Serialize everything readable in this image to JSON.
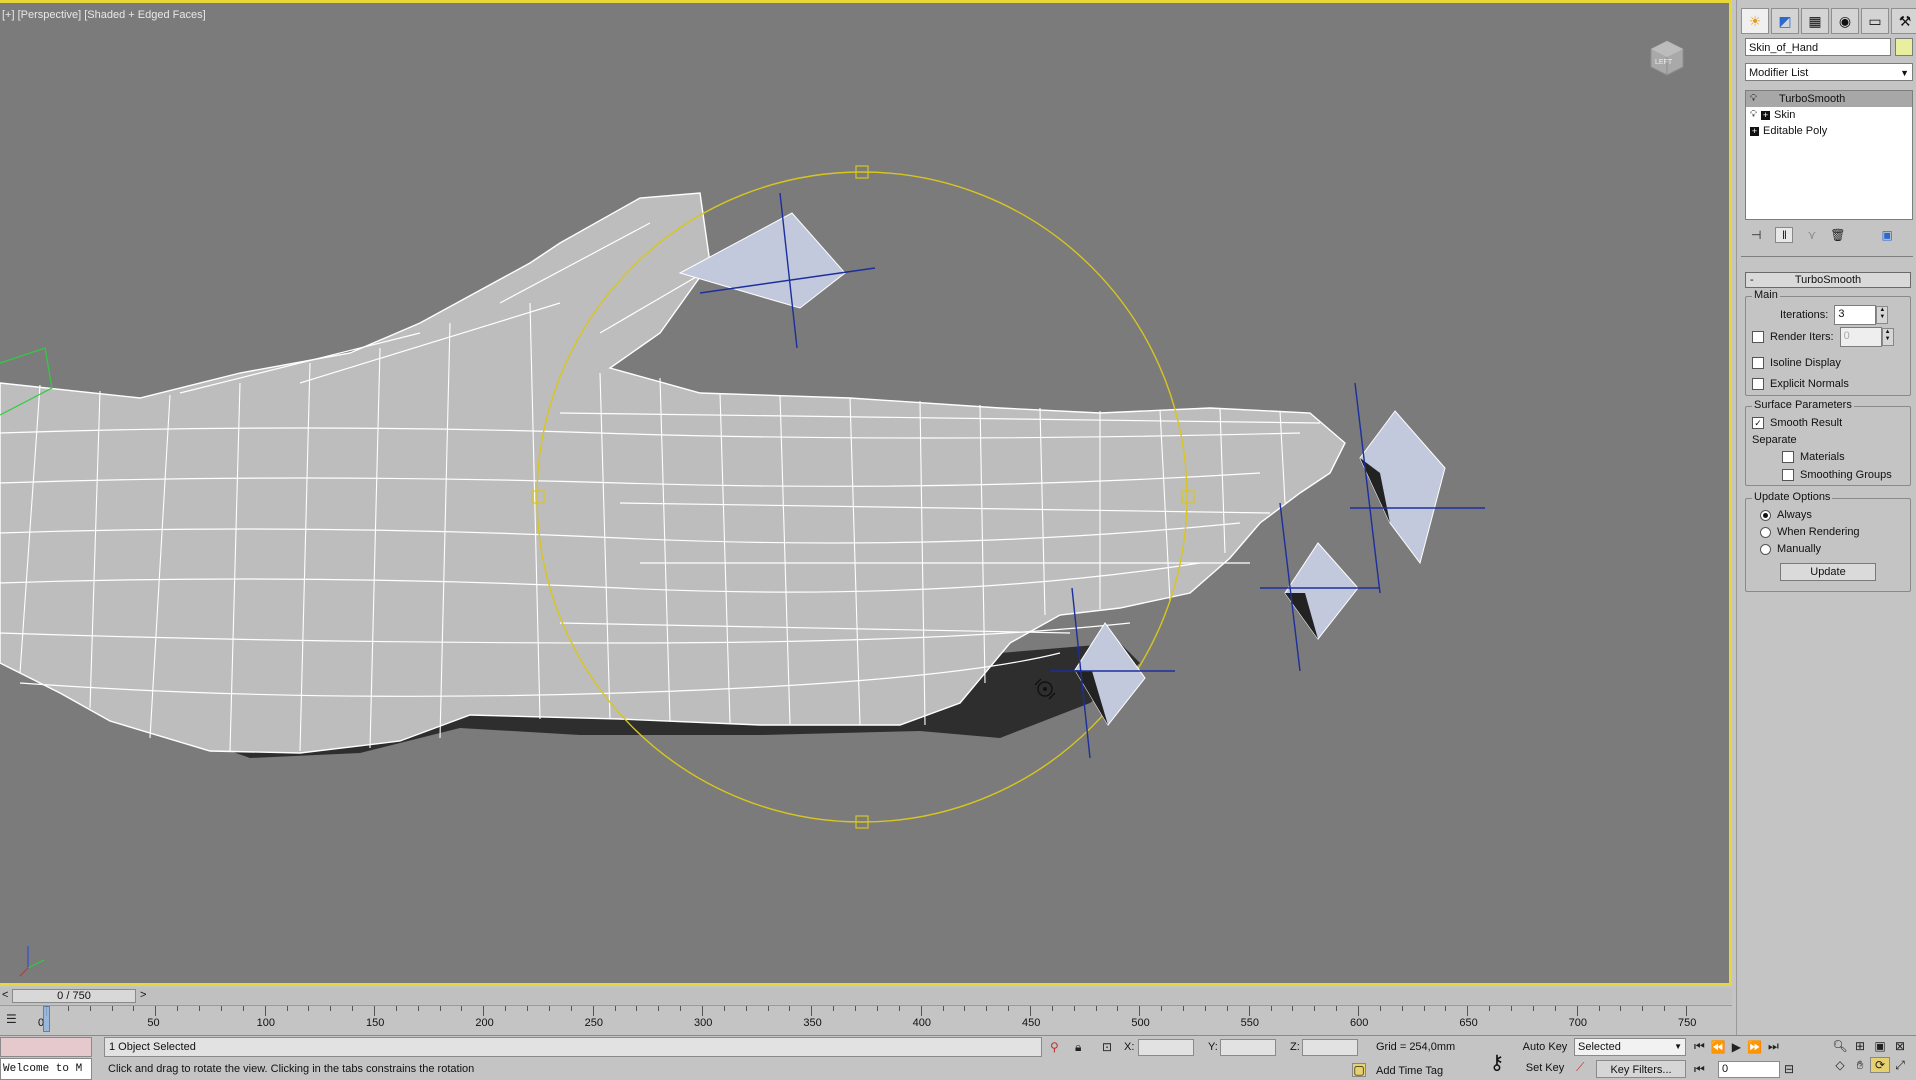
{
  "viewport": {
    "label": "[+] [Perspective] [Shaded + Edged Faces]",
    "viewcube_label": "LEFT",
    "axis_labels": {
      "x": "x",
      "y": "y",
      "z": "z"
    }
  },
  "command_panel": {
    "tabs": [
      {
        "name": "create-tab",
        "glyph": "☀",
        "active": true
      },
      {
        "name": "modify-tab",
        "glyph": "◩",
        "active": false
      },
      {
        "name": "hierarchy-tab",
        "glyph": "▦",
        "active": false
      },
      {
        "name": "motion-tab",
        "glyph": "◉",
        "active": false
      },
      {
        "name": "display-tab",
        "glyph": "▭",
        "active": false
      },
      {
        "name": "utilities-tab",
        "glyph": "⚒",
        "active": false
      }
    ],
    "object_name": "Skin_of_Hand",
    "object_color": "#e8f0a0",
    "modifier_list_label": "Modifier List",
    "stack": [
      {
        "label": "TurboSmooth",
        "selected": true,
        "bulb": true,
        "plus": false
      },
      {
        "label": "Skin",
        "selected": false,
        "bulb": true,
        "plus": true
      },
      {
        "label": "Editable Poly",
        "selected": false,
        "bulb": false,
        "plus": true
      }
    ],
    "stack_tools": [
      "pin-stack",
      "show-end-result",
      "make-unique",
      "remove-modifier",
      "configure-sets"
    ]
  },
  "turbosmooth": {
    "rollout_title": "TurboSmooth",
    "rollout_toggle": "-",
    "main_title": "Main",
    "iterations_label": "Iterations:",
    "iterations_value": "3",
    "render_iters_label": "Render Iters:",
    "render_iters_value": "0",
    "render_iters_checked": false,
    "isoline_label": "Isoline Display",
    "isoline_checked": false,
    "explicit_normals_label": "Explicit Normals",
    "explicit_normals_checked": false,
    "surface_title": "Surface Parameters",
    "smooth_result_label": "Smooth Result",
    "smooth_result_checked": true,
    "separate_label": "Separate",
    "materials_label": "Materials",
    "materials_checked": false,
    "smoothing_groups_label": "Smoothing Groups",
    "smoothing_groups_checked": false,
    "update_title": "Update Options",
    "update_options": [
      {
        "label": "Always",
        "selected": true
      },
      {
        "label": "When Rendering",
        "selected": false
      },
      {
        "label": "Manually",
        "selected": false
      }
    ],
    "update_button": "Update"
  },
  "timeline": {
    "frame_display": "0 / 750",
    "prev": "<",
    "next": ">",
    "ticks": [
      "0",
      "50",
      "100",
      "150",
      "200",
      "250",
      "300",
      "350",
      "400",
      "450",
      "500",
      "550",
      "600",
      "650",
      "700",
      "750"
    ],
    "max_frame": 750,
    "current_frame": 0
  },
  "status": {
    "maxscript_text": "Welcome to M",
    "selection_info": "1 Object Selected",
    "prompt": "Click and drag to rotate the view.  Clicking in the tabs constrains the rotation",
    "x_label": "X:",
    "y_label": "Y:",
    "z_label": "Z:",
    "x_value": "",
    "y_value": "",
    "z_value": "",
    "grid": "Grid = 254,0mm",
    "add_time_tag": "Add Time Tag",
    "auto_key": "Auto Key",
    "set_key": "Set Key",
    "key_mode_selected": "Selected",
    "key_filters": "Key Filters...",
    "frame_field": "0"
  },
  "colors": {
    "viewport_bg": "#7b7b7b",
    "viewport_border": "#e6d83a",
    "ui_bg": "#c4c4c4",
    "gizmo": "#d8c61e",
    "bone_axis": "#1c2f9e"
  }
}
